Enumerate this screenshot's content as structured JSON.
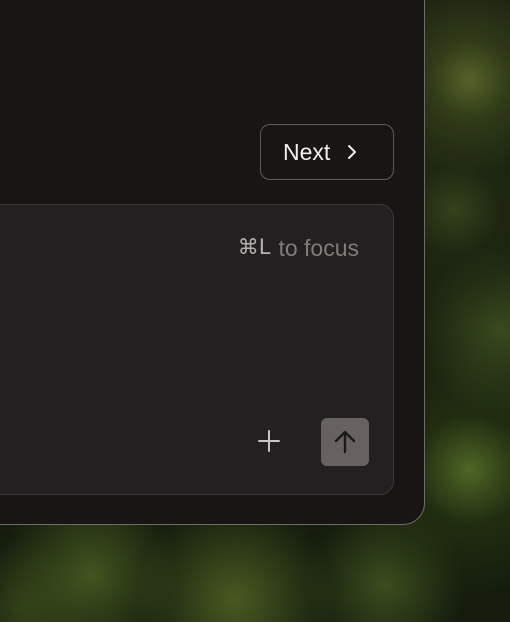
{
  "navigation": {
    "next_label": "Next",
    "next_icon": "chevron-right-icon"
  },
  "composer": {
    "shortcut": "⌘L",
    "hint_text": "to focus",
    "add_icon": "plus-icon",
    "send_icon": "arrow-up-icon"
  },
  "colors": {
    "window_bg": "#181514",
    "composer_bg": "#222020",
    "send_button_bg": "#67625f",
    "text_primary": "#f1efed",
    "text_muted": "#807c79"
  }
}
